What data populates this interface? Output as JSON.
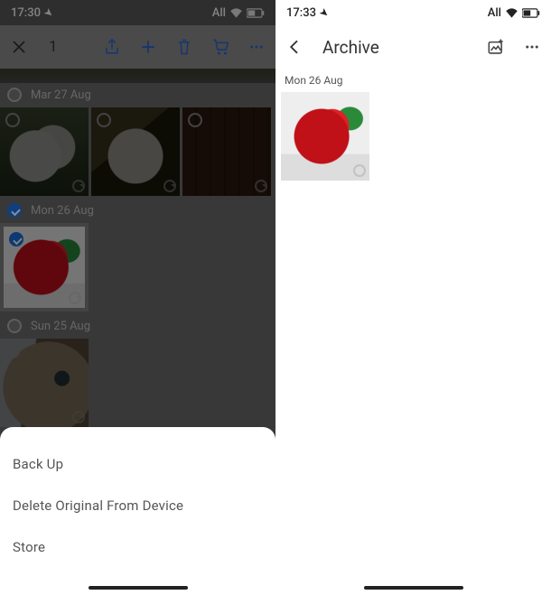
{
  "left": {
    "status": {
      "time": "17:30",
      "net": "All"
    },
    "topbar": {
      "count": "1"
    },
    "sections": [
      {
        "date": "Mar 27 Aug",
        "selected": false
      },
      {
        "date": "Mon 26 Aug",
        "selected": true
      },
      {
        "date": "Sun 25 Aug",
        "selected": false
      }
    ],
    "sheet": {
      "opt1": "Back Up",
      "opt2": "Delete Original From Device",
      "opt3": "Store"
    }
  },
  "right": {
    "status": {
      "time": "17:33",
      "net": "All"
    },
    "title": "Archive",
    "date": "Mon 26 Aug"
  },
  "icons": {
    "close": "close-icon",
    "share": "share-icon",
    "plus": "plus-icon",
    "trash": "trash-icon",
    "cart": "cart-icon",
    "more": "more-icon",
    "back": "back-icon",
    "addphoto": "add-photo-icon",
    "location": "location-icon",
    "wifi": "wifi-icon",
    "battery": "battery-icon"
  }
}
